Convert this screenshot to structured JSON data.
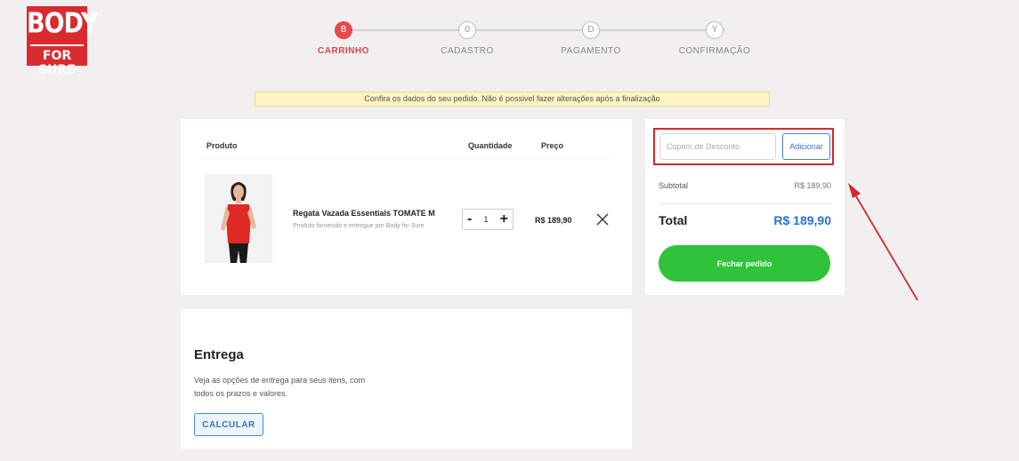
{
  "logo": {
    "line1": "BODY",
    "line2": "FOR SURE"
  },
  "stepper": [
    {
      "glyph": "B",
      "label": "CARRINHO",
      "active": true
    },
    {
      "glyph": "0",
      "label": "CADASTRO",
      "active": false
    },
    {
      "glyph": "D",
      "label": "PAGAMENTO",
      "active": false
    },
    {
      "glyph": "Y",
      "label": "CONFIRMAÇÃO",
      "active": false
    }
  ],
  "notice": "Confira os dados do seu pedido. Não é possivel fazer alterações após a finalização",
  "cart": {
    "headers": {
      "product": "Produto",
      "quantity": "Quantidade",
      "price": "Preço"
    },
    "item": {
      "name": "Regata Vazada Essentials TOMATE M",
      "subtitle": "Produto fornecido e entregue por Body for Sure",
      "qty": "1",
      "minus": "-",
      "plus": "+",
      "price": "R$ 189,90"
    }
  },
  "summary": {
    "coupon_placeholder": "Cupom de Desconto",
    "coupon_button": "Adicionar",
    "subtotal_label": "Subtotal",
    "subtotal_value": "R$ 189,90",
    "total_label": "Total",
    "total_value": "R$ 189,90",
    "checkout_button": "Fechar pedido"
  },
  "delivery": {
    "title": "Entrega",
    "description": "Veja as opções de entrega para seus itens, com todos os prazos e valores.",
    "button": "CALCULAR"
  },
  "colors": {
    "brand": "#d92b2e",
    "accent_blue": "#2c6fd6",
    "checkout_green": "#2fc33a",
    "highlight_red": "#d22a2a"
  }
}
